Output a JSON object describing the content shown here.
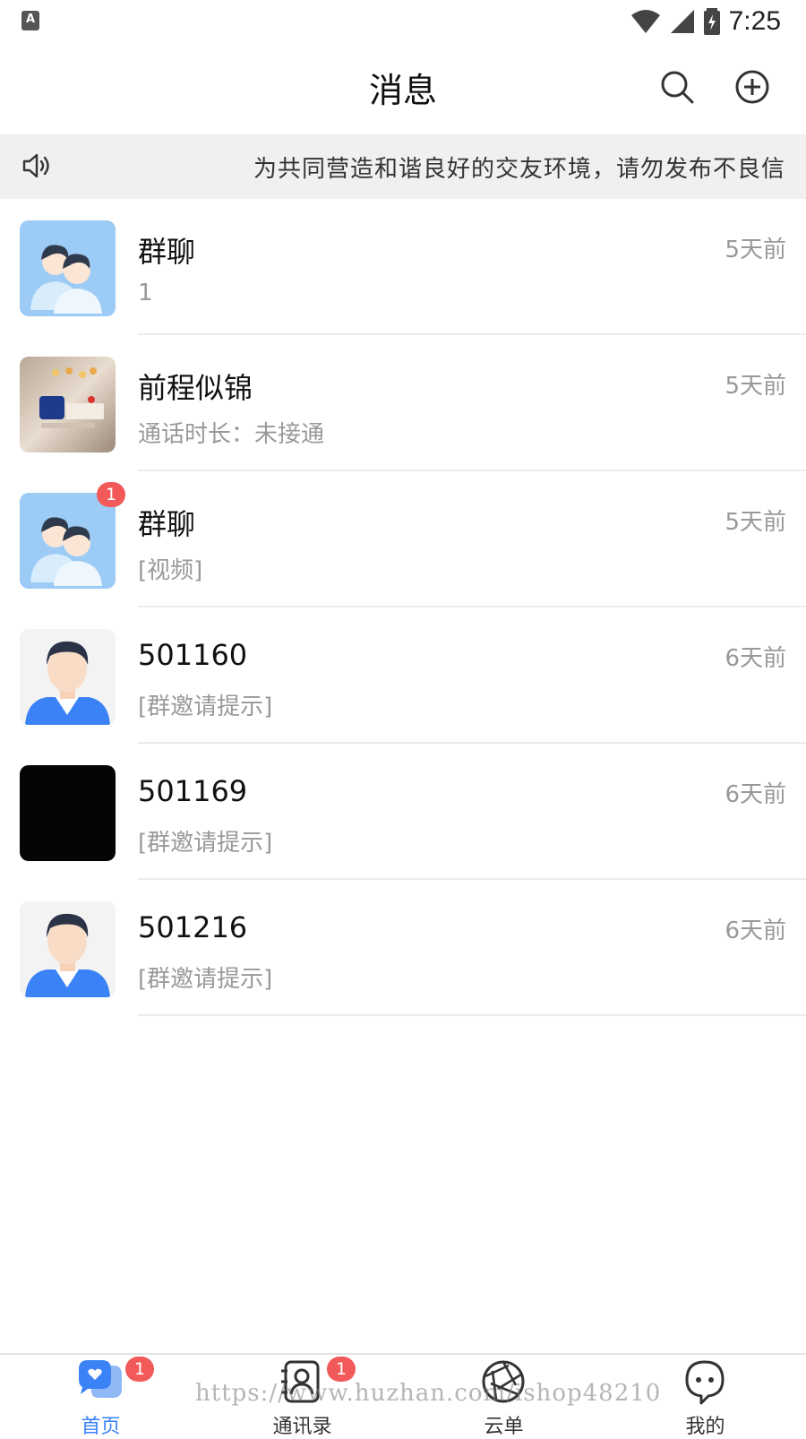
{
  "status_bar": {
    "time": "7:25",
    "app_icon_letter": "A"
  },
  "header": {
    "title": "消息",
    "search_icon": "search-icon",
    "add_icon": "plus-circle-icon"
  },
  "notice": {
    "icon": "speaker-icon",
    "text": "为共同营造和谐良好的交友环境，请勿发布不良信"
  },
  "conversations": [
    {
      "name": "群聊",
      "message": "1",
      "time": "5天前",
      "avatar": "group-avatar",
      "badge": ""
    },
    {
      "name": "前程似锦",
      "message": "通话时长：未接通",
      "time": "5天前",
      "avatar": "photo-avatar",
      "badge": ""
    },
    {
      "name": "群聊",
      "message": "[视频]",
      "time": "5天前",
      "avatar": "group-avatar",
      "badge": "1"
    },
    {
      "name": "501160",
      "message": "[群邀请提示]",
      "time": "6天前",
      "avatar": "man-avatar",
      "badge": ""
    },
    {
      "name": "501169",
      "message": "[群邀请提示]",
      "time": "6天前",
      "avatar": "black-avatar",
      "badge": ""
    },
    {
      "name": "501216",
      "message": "[群邀请提示]",
      "time": "6天前",
      "avatar": "man-avatar",
      "badge": ""
    }
  ],
  "tabs": [
    {
      "label": "首页",
      "icon": "home-chat-icon",
      "badge": "1",
      "active": true
    },
    {
      "label": "通讯录",
      "icon": "contacts-icon",
      "badge": "1",
      "active": false
    },
    {
      "label": "云单",
      "icon": "aperture-icon",
      "badge": "",
      "active": false
    },
    {
      "label": "我的",
      "icon": "profile-chat-icon",
      "badge": "",
      "active": false
    }
  ],
  "colors": {
    "accent": "#3b82f6",
    "badge": "#f25a5a",
    "notice_bg": "#f0f0f0"
  },
  "watermark": "https://www.huzhan.com/ishop48210"
}
